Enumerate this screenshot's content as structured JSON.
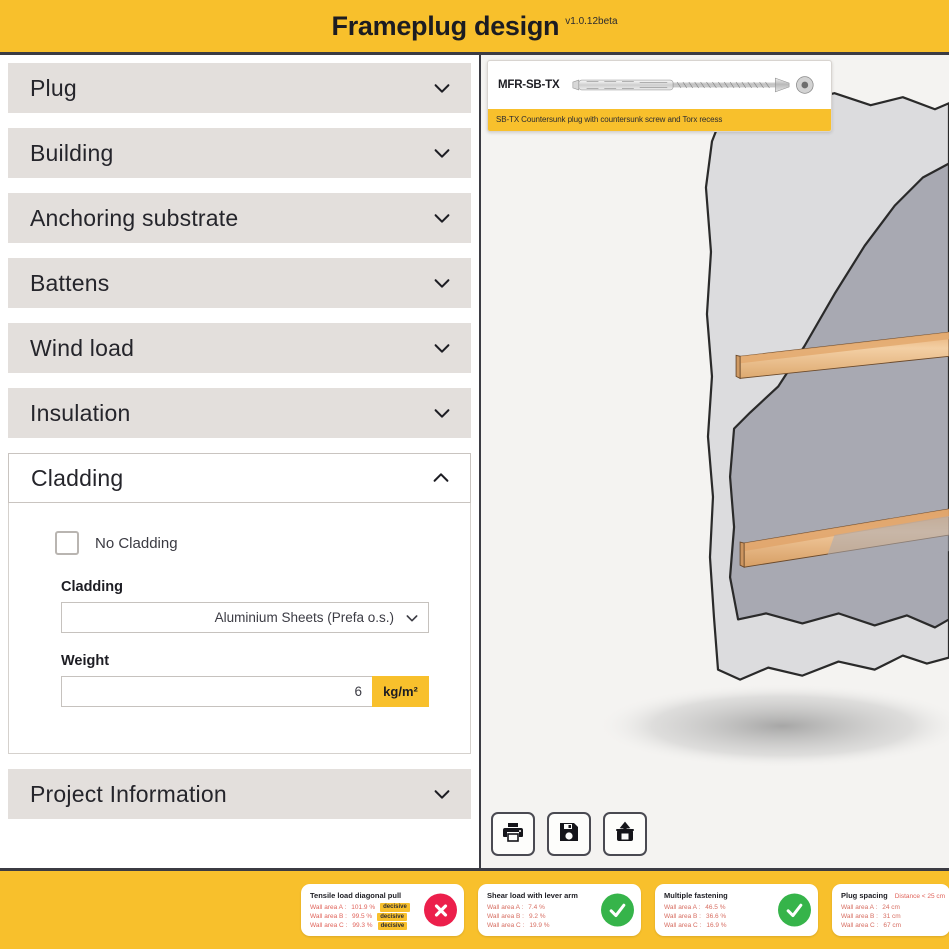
{
  "header": {
    "title": "Frameplug design",
    "version": "v1.0.12beta",
    "bg_color": "#f8c02c"
  },
  "sidebar": {
    "sections": [
      {
        "label": "Plug",
        "icon": "chevron-down-icon",
        "open": false
      },
      {
        "label": "Building",
        "icon": "chevron-down-icon",
        "open": false
      },
      {
        "label": "Anchoring substrate",
        "icon": "chevron-down-icon",
        "open": false
      },
      {
        "label": "Battens",
        "icon": "chevron-down-icon",
        "open": false
      },
      {
        "label": "Wind load",
        "icon": "chevron-down-icon",
        "open": false
      },
      {
        "label": "Insulation",
        "icon": "chevron-down-icon",
        "open": false
      },
      {
        "label": "Cladding",
        "icon": "chevron-up-icon",
        "open": true
      },
      {
        "label": "Project Information",
        "icon": "chevron-down-icon",
        "open": false
      }
    ],
    "cladding_panel": {
      "no_cladding_label": "No Cladding",
      "no_cladding_checked": false,
      "cladding_field_label": "Cladding",
      "cladding_value": "Aluminium Sheets (Prefa o.s.)",
      "cladding_dropdown_icon": "chevron-down-icon",
      "weight_field_label": "Weight",
      "weight_value": "6",
      "weight_unit": "kg/m²"
    }
  },
  "viewport": {
    "product_card": {
      "code": "MFR-SB-TX",
      "description": "SB-TX Countersunk plug with countersunk screw and Torx recess",
      "accent_color": "#f8c02c"
    },
    "tools": [
      {
        "name": "print-button",
        "icon": "printer-icon"
      },
      {
        "name": "save-button",
        "icon": "floppy-disk-icon"
      },
      {
        "name": "export-button",
        "icon": "share-upload-icon"
      }
    ]
  },
  "results": [
    {
      "title": "Tensile load diagonal pull",
      "subtitle": "",
      "status": "fail",
      "status_icon": "cross-circle-icon",
      "rows": [
        {
          "label": "Wall area A :",
          "value": "101.9 %",
          "badge": "decisive"
        },
        {
          "label": "Wall area B :",
          "value": "99.5 %",
          "badge": "decisive"
        },
        {
          "label": "Wall area C :",
          "value": "99.3 %",
          "badge": "decisive"
        }
      ]
    },
    {
      "title": "Shear load with lever arm",
      "subtitle": "",
      "status": "pass",
      "status_icon": "check-circle-icon",
      "rows": [
        {
          "label": "Wall area A :",
          "value": "7.4 %",
          "badge": ""
        },
        {
          "label": "Wall area B :",
          "value": "9.2 %",
          "badge": ""
        },
        {
          "label": "Wall area C :",
          "value": "19.9 %",
          "badge": ""
        }
      ]
    },
    {
      "title": "Multiple fastening",
      "subtitle": "",
      "status": "pass",
      "status_icon": "check-circle-icon",
      "rows": [
        {
          "label": "Wall area A :",
          "value": "46.5 %",
          "badge": ""
        },
        {
          "label": "Wall area B :",
          "value": "36.6 %",
          "badge": ""
        },
        {
          "label": "Wall area C :",
          "value": "16.9 %",
          "badge": ""
        }
      ]
    },
    {
      "title": "Plug spacing",
      "subtitle": "Distance < 25 cm",
      "status": "none",
      "status_icon": "",
      "rows": [
        {
          "label": "Wall area A :",
          "value": "24 cm",
          "badge": ""
        },
        {
          "label": "Wall area B :",
          "value": "31 cm",
          "badge": ""
        },
        {
          "label": "Wall area C :",
          "value": "67 cm",
          "badge": ""
        }
      ]
    }
  ]
}
